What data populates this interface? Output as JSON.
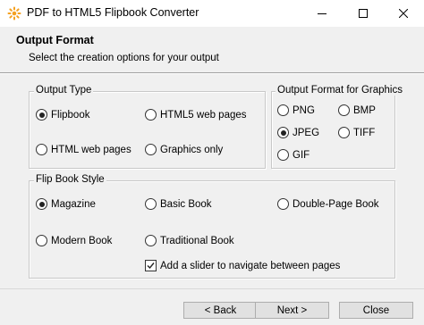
{
  "window": {
    "title": "PDF to HTML5 Flipbook Converter"
  },
  "header": {
    "title": "Output Format",
    "subtitle": "Select the creation options for your output"
  },
  "output_type": {
    "label": "Output Type",
    "options": [
      {
        "label": "Flipbook",
        "checked": true
      },
      {
        "label": "HTML5 web pages",
        "checked": false
      },
      {
        "label": "HTML web pages",
        "checked": false
      },
      {
        "label": "Graphics only",
        "checked": false
      }
    ]
  },
  "graphics_format": {
    "label": "Output Format for Graphics",
    "options": [
      {
        "label": "PNG",
        "checked": false
      },
      {
        "label": "BMP",
        "checked": false
      },
      {
        "label": "JPEG",
        "checked": true
      },
      {
        "label": "TIFF",
        "checked": false
      },
      {
        "label": "GIF",
        "checked": false
      }
    ]
  },
  "flip_book_style": {
    "label": "Flip Book Style",
    "options": [
      {
        "label": "Magazine",
        "checked": true
      },
      {
        "label": "Basic Book",
        "checked": false
      },
      {
        "label": "Double-Page Book",
        "checked": false
      },
      {
        "label": "Modern Book",
        "checked": false
      },
      {
        "label": "Traditional Book",
        "checked": false
      }
    ],
    "slider_checkbox": {
      "label": "Add a slider to navigate between pages",
      "checked": true
    }
  },
  "buttons": {
    "back": "< Back",
    "next": "Next >",
    "close": "Close"
  },
  "colors": {
    "accent_icon": "#f4a020"
  }
}
